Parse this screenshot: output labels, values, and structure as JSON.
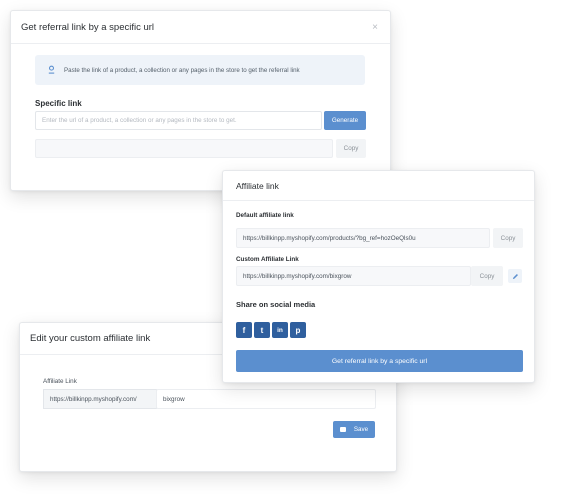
{
  "referral_modal": {
    "title": "Get referral link by a specific url",
    "close": "×",
    "info_text": "Paste the link of a product, a collection or any pages in the store to get the referral link",
    "specific_link_label": "Specific link",
    "input_placeholder": "Enter the url of a product, a collection or any pages in the store to get.",
    "generate_label": "Generate",
    "result_value": "",
    "copy_label": "Copy"
  },
  "affiliate_card": {
    "title": "Affiliate link",
    "default_label": "Default affiliate link",
    "default_value": "https://billkinpp.myshopify.com/products/?bg_ref=hozOeQls0u",
    "default_copy": "Copy",
    "custom_label": "Custom Affiliate Link",
    "custom_value": "https://billkinpp.myshopify.com/bixgrow",
    "custom_copy": "Copy",
    "share_label": "Share on social media",
    "social": [
      {
        "name": "facebook",
        "glyph": "f"
      },
      {
        "name": "twitter",
        "glyph": "t"
      },
      {
        "name": "linkedin",
        "glyph": "in"
      },
      {
        "name": "pinterest",
        "glyph": "p"
      }
    ],
    "referral_button": "Get referral link by a specific url"
  },
  "custom_modal": {
    "title": "Edit your custom affiliate link",
    "field_label": "Affiliate Link",
    "prefix": "https://billkinpp.myshopify.com/",
    "value": "bixgrow",
    "save_label": "Save"
  },
  "colors": {
    "primary": "#5b8fcf",
    "info_bg": "#eef3f9",
    "social": "#2f5f9e"
  }
}
